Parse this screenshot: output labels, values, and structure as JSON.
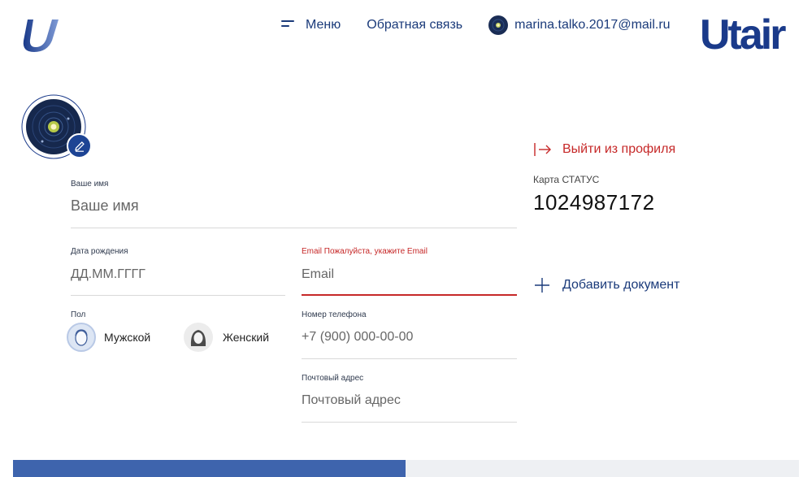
{
  "header": {
    "menu_label": "Меню",
    "feedback_label": "Обратная связь",
    "user_email": "marina.talko.2017@mail.ru",
    "brand": "Utair"
  },
  "profile": {
    "logout_label": "Выйти из профиля",
    "status_card_label": "Карта СТАТУС",
    "status_card_number": "1024987172",
    "add_document_label": "Добавить документ"
  },
  "form": {
    "name": {
      "label": "Ваше имя",
      "placeholder": "Ваше имя"
    },
    "birthdate": {
      "label": "Дата рождения",
      "placeholder": "ДД.ММ.ГГГГ"
    },
    "email": {
      "label": "Email Пожалуйста, укажите Email",
      "placeholder": "Email"
    },
    "gender": {
      "label": "Пол",
      "options": [
        "Мужской",
        "Женский"
      ]
    },
    "phone": {
      "label": "Номер телефона",
      "placeholder": "+7 (900) 000-00-00"
    },
    "address": {
      "label": "Почтовый адрес",
      "placeholder": "Почтовый адрес"
    }
  },
  "colors": {
    "brand": "#1a3a8a",
    "error": "#c62828",
    "active_tab": "#3e64ad",
    "inactive_tab": "#eef0f3"
  },
  "icons": [
    "utair-logo-icon",
    "menu-icon",
    "user-avatar-icon",
    "edit-icon",
    "logout-icon",
    "plus-icon",
    "male-face-icon",
    "female-face-icon"
  ]
}
